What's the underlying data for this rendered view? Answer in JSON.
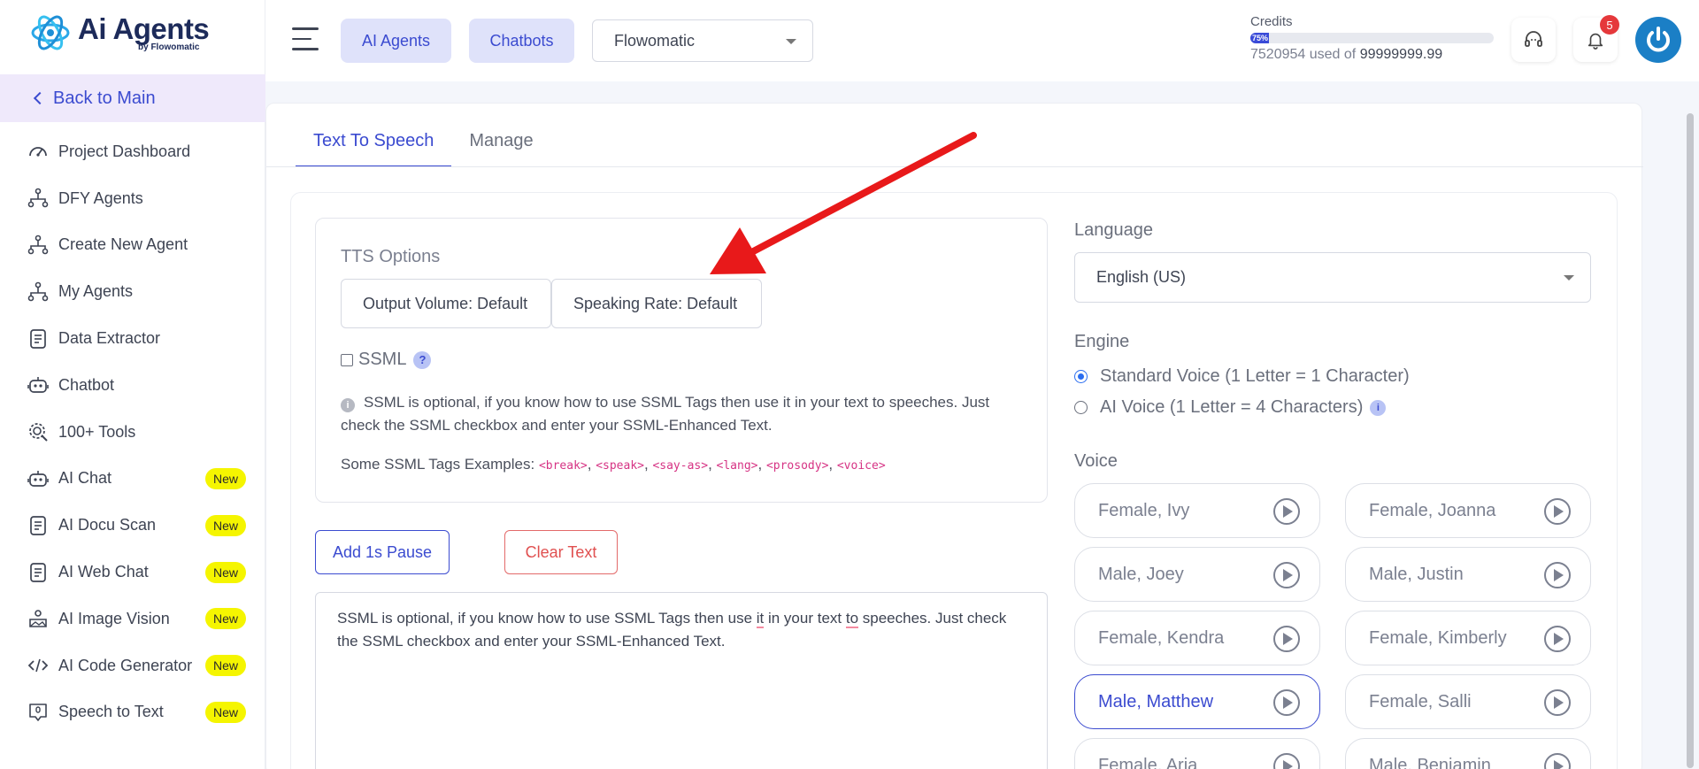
{
  "brand": {
    "name": "Ai Agents",
    "sub": "by Flowomatic"
  },
  "sidebar": {
    "back_label": "Back to Main",
    "items": [
      {
        "label": "Project Dashboard",
        "icon": "gauge-icon",
        "badge": ""
      },
      {
        "label": "DFY Agents",
        "icon": "agent-tree-icon",
        "badge": ""
      },
      {
        "label": "Create New Agent",
        "icon": "agent-tree-icon",
        "badge": ""
      },
      {
        "label": "My Agents",
        "icon": "agent-tree-icon",
        "badge": ""
      },
      {
        "label": "Data Extractor",
        "icon": "document-icon",
        "badge": ""
      },
      {
        "label": "Chatbot",
        "icon": "robot-icon",
        "badge": ""
      },
      {
        "label": "100+ Tools",
        "icon": "tools-gear-icon",
        "badge": ""
      },
      {
        "label": "AI Chat",
        "icon": "robot-icon",
        "badge": "New"
      },
      {
        "label": "AI Docu Scan",
        "icon": "document-icon",
        "badge": "New"
      },
      {
        "label": "AI Web Chat",
        "icon": "document-icon",
        "badge": "New"
      },
      {
        "label": "AI Image Vision",
        "icon": "vision-icon",
        "badge": "New"
      },
      {
        "label": "AI Code Generator",
        "icon": "code-icon",
        "badge": "New"
      },
      {
        "label": "Speech to Text",
        "icon": "mic-speech-icon",
        "badge": "New"
      }
    ]
  },
  "topbar": {
    "btn_agents": "AI Agents",
    "btn_chatbots": "Chatbots",
    "workspace": "Flowomatic",
    "credits_label": "Credits",
    "credits_pct_label": "75%",
    "credits_fraction": 0.075,
    "credits_used": "7520954",
    "credits_used_of": "used of",
    "credits_total": "99999999.99",
    "notif_count": "5"
  },
  "tabs": [
    "Text To Speech",
    "Manage"
  ],
  "tts": {
    "title": "TTS Options",
    "output_volume": "Output Volume: Default",
    "speaking_rate": "Speaking Rate: Default",
    "ssml_label": "SSML",
    "info": "SSML is optional, if you know how to use SSML Tags then use it in your text to speeches. Just check the SSML checkbox and enter your SSML-Enhanced Text.",
    "examples_label": "Some SSML Tags Examples:",
    "examples": [
      "<break>",
      "<speak>",
      "<say-as>",
      "<lang>",
      "<prosody>",
      "<voice>"
    ],
    "add_pause": "Add 1s Pause",
    "clear_text": "Clear Text",
    "text_prefix": "SSML is optional, if you know how to use SSML Tags then use ",
    "text_it": "it",
    "text_mid": " in your text ",
    "text_to": "to",
    "text_suffix": " speeches. Just check the SSML checkbox and enter your SSML-Enhanced Text."
  },
  "settings": {
    "language_label": "Language",
    "language_value": "English (US)",
    "engine_label": "Engine",
    "engine_standard": "Standard Voice (1 Letter = 1 Character)",
    "engine_ai": "AI Voice (1 Letter = 4 Characters)",
    "voice_label": "Voice",
    "voices": [
      "Female, Ivy",
      "Female, Joanna",
      "Male, Joey",
      "Male, Justin",
      "Female, Kendra",
      "Female, Kimberly",
      "Male, Matthew",
      "Female, Salli",
      "Female, Aria",
      "Male, Benjamin"
    ],
    "selected_voice": "Male, Matthew"
  },
  "colors": {
    "accent": "#3b4bd0",
    "annotation_arrow": "#e8191a",
    "badge_new": "#f5f500"
  }
}
